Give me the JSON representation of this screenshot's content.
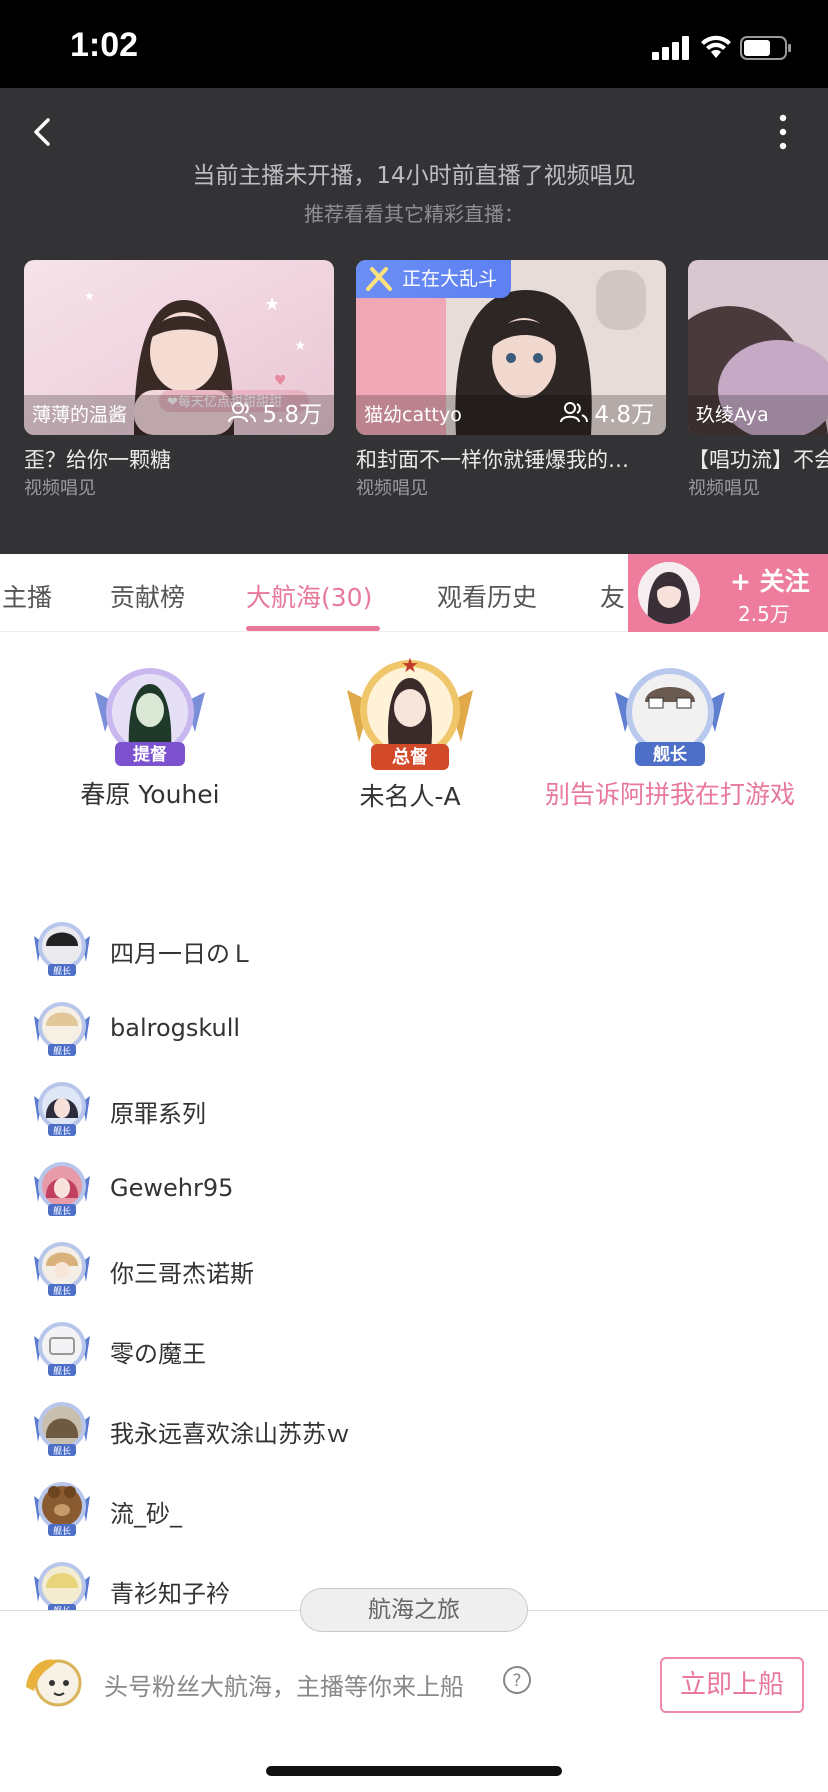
{
  "status_bar": {
    "time": "1:02"
  },
  "header": {
    "notice": "当前主播未开播，14小时前直播了视频唱见",
    "recommend": "推荐看看其它精彩直播："
  },
  "cards": [
    {
      "streamer": "薄薄的温酱",
      "viewers": "5.8万",
      "title": "歪？给你一颗糖",
      "category": "视频唱见",
      "overlay_text": "❤每天亿点甜甜甜甜",
      "badge": ""
    },
    {
      "streamer": "猫幼cattyo",
      "viewers": "4.8万",
      "title": "和封面不一样你就锤爆我的…",
      "category": "视频唱见",
      "overlay_text": "",
      "badge": "正在大乱斗"
    },
    {
      "streamer": "玖绫Aya",
      "viewers": "",
      "title": "【唱功流】不会",
      "category": "视频唱见",
      "overlay_text": "",
      "badge": ""
    }
  ],
  "tabs": [
    {
      "label": "主播"
    },
    {
      "label": "贡献榜"
    },
    {
      "label": "大航海(30)"
    },
    {
      "label": "观看历史"
    },
    {
      "label": "友"
    }
  ],
  "follow": {
    "label": "+ 关注",
    "count": "2.5万"
  },
  "top3": [
    {
      "name": "春原 Youhei",
      "rank_label": "提督"
    },
    {
      "name": "未名人-A",
      "rank_label": "总督"
    },
    {
      "name": "别告诉阿拼我在打游戏",
      "rank_label": "舰长"
    }
  ],
  "crew": [
    {
      "name": "四月一日のＬ",
      "badge": "舰长"
    },
    {
      "name": "balrogskull",
      "badge": "舰长"
    },
    {
      "name": "原罪系列",
      "badge": "舰长"
    },
    {
      "name": "Gewehr95",
      "badge": "舰长"
    },
    {
      "name": "你三哥杰诺斯",
      "badge": "舰长"
    },
    {
      "name": "零の魔王",
      "badge": "舰长"
    },
    {
      "name": "我永远喜欢涂山苏苏ｗ",
      "badge": "舰长"
    },
    {
      "name": "流_砂_",
      "badge": "舰长"
    },
    {
      "name": "青衫知子衿",
      "badge": "舰长"
    }
  ],
  "bottom": {
    "voyage_tab": "航海之旅",
    "promo": "头号粉丝大航海，主播等你来上船",
    "board_button": "立即上船"
  },
  "colors": {
    "accent": "#e8799b",
    "header_bg": "#333335",
    "follow_bg": "#ee7c9c",
    "battle_badge": "#6b8ff5"
  }
}
